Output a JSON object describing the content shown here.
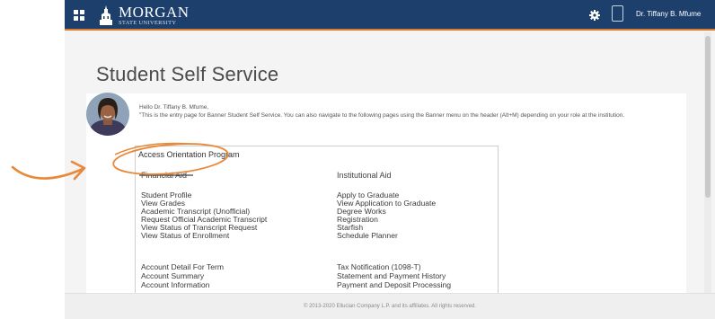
{
  "header": {
    "brand_line1": "MORGAN",
    "brand_line2": "STATE UNIVERSITY",
    "user_name": "Dr. Tiffany B. Mfume"
  },
  "page": {
    "title": "Student Self Service",
    "greeting_hello": "Hello Dr. Tiffany B. Mfume,",
    "greeting_message": "\"This is the entry page for Banner Student Self Service. You can also navigate to the following pages using the Banner menu on the header (Alt+M) depending on your role at the institution."
  },
  "menu": {
    "header": "Access Orientation Program",
    "left_head": "Financial Aid",
    "right_head": "Institutional Aid",
    "left_group1": [
      "Student Profile",
      "View Grades",
      "Academic Transcript (Unofficial)",
      "Request Official Academic Transcript",
      "View Status of Transcript Request",
      "View Status of Enrollment"
    ],
    "right_group1": [
      "Apply to Graduate",
      "View Application to Graduate",
      "Degree Works",
      "Registration",
      "Starfish",
      "Schedule Planner"
    ],
    "left_group2": [
      "Account Detail For Term",
      "Account Summary",
      "Account Information"
    ],
    "right_group2": [
      "Tax Notification (1098-T)",
      "Statement and Payment History",
      "Payment and Deposit Processing"
    ]
  },
  "footer": {
    "text": "© 2013-2020 Ellucian Company L.P. and its affiliates. All rights reserved."
  },
  "colors": {
    "topbar": "#1d3f6b",
    "accent_orange": "#e07a2b"
  },
  "icons": [
    "grid-menu-icon",
    "morgan-logo-icon",
    "gear-icon",
    "user-avatar-icon"
  ]
}
